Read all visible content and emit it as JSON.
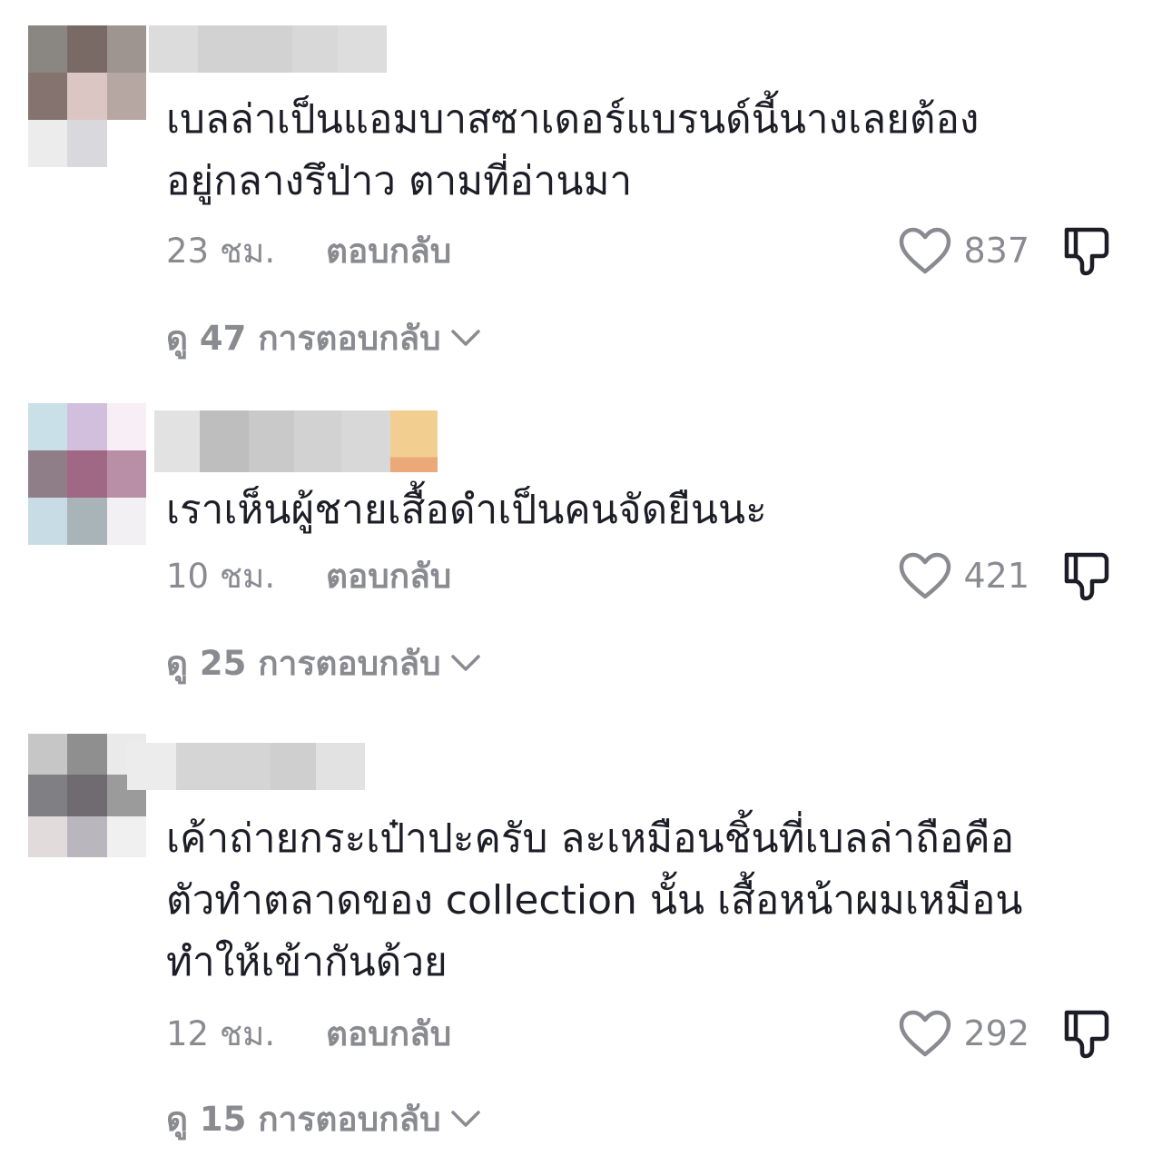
{
  "comments": [
    {
      "text": "เบลล่าเป็นแอมบาสซาเดอร์แบรนด์นี้นางเลยต้อง\nอยู่กลางรึป่าว ตามที่อ่านมา",
      "time": "23 ชม.",
      "reply_label": "ตอบกลับ",
      "likes": "837",
      "view_replies": "ดู 47 การตอบกลับ"
    },
    {
      "text": "เราเห็นผู้ชายเสื้อดำเป็นคนจัดยืนนะ",
      "time": "10 ชม.",
      "reply_label": "ตอบกลับ",
      "likes": "421",
      "view_replies": "ดู 25 การตอบกลับ"
    },
    {
      "text": "เค้าถ่ายกระเป๋าปะครับ ละเหมือนชิ้นที่เบลล่าถือคือ\nตัวทำตลาดของ collection นั้น เสื้อหน้าผมเหมือน\nทำให้เข้ากันด้วย",
      "time": "12 ชม.",
      "reply_label": "ตอบกลับ",
      "likes": "292",
      "view_replies": "ดู 15 การตอบกลับ"
    }
  ],
  "colors": {
    "text": "#1c1d26",
    "secondary": "#8a8b91",
    "background": "#ffffff"
  },
  "icons": {
    "like": "heart-outline-icon",
    "dislike": "thumbs-down-outline-icon",
    "expand": "chevron-down-icon"
  }
}
